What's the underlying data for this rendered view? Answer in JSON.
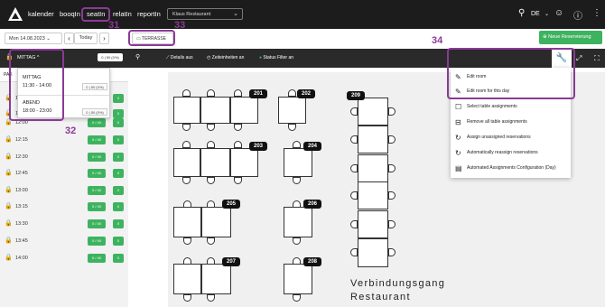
{
  "topbar": {
    "nav": [
      "kalender",
      "booqIn",
      "seatIn",
      "relatIn",
      "reportIn"
    ],
    "restaurant": "Klaus Restaurant",
    "language": "DE"
  },
  "toolbar": {
    "date": "Mon 14.08.2023",
    "today": "Today",
    "area": "TERRASSE",
    "new_reservation": "Neue Reservierung"
  },
  "controls": {
    "shift": "MITTAG",
    "capacity": "0 | 50 (0%)",
    "details": "Details aus",
    "time_units": "Zeiteinheiten an",
    "status_filter": "Status Filter an"
  },
  "shift_dropdown": [
    {
      "name": "MITTAG",
      "hours": "11:30 - 14:00",
      "capacity": "0 | 50 (0%)"
    },
    {
      "name": "ABEND",
      "hours": "18:00 - 23:00",
      "capacity": "0 | 50 (0%)"
    }
  ],
  "sidebar": {
    "header": "PAX",
    "slots": [
      {
        "time": "11:30",
        "occ": "0 / 40",
        "n": "0"
      },
      {
        "time": "11:45",
        "occ": "0 / 40",
        "n": "0"
      },
      {
        "time": "12:00",
        "occ": "0 / 40",
        "n": "0"
      },
      {
        "time": "12:15",
        "occ": "0 / 40",
        "n": "0"
      },
      {
        "time": "12:30",
        "occ": "0 / 40",
        "n": "0"
      },
      {
        "time": "12:45",
        "occ": "0 / 40",
        "n": "0"
      },
      {
        "time": "13:00",
        "occ": "0 / 40",
        "n": "0"
      },
      {
        "time": "13:15",
        "occ": "0 / 40",
        "n": "0"
      },
      {
        "time": "13:30",
        "occ": "0 / 40",
        "n": "0"
      },
      {
        "time": "13:45",
        "occ": "0 / 40",
        "n": "0"
      },
      {
        "time": "14:00",
        "occ": "0 / 40",
        "n": "0"
      }
    ]
  },
  "tables": [
    "201",
    "202",
    "203",
    "204",
    "205",
    "206",
    "207",
    "208",
    "209"
  ],
  "venue": {
    "line1": "Verbindungsgang",
    "line2": "Restaurant"
  },
  "room_menu": [
    {
      "label": "Edit room",
      "icon": "pencil-icon"
    },
    {
      "label": "Edit room for this day",
      "icon": "pencil-calendar-icon"
    },
    {
      "label": "Select table assignments",
      "icon": "checkbox-icon"
    },
    {
      "label": "Remove all table assignments",
      "icon": "remove-icon"
    },
    {
      "label": "Assign unassigned reservations",
      "icon": "assign-icon"
    },
    {
      "label": "Automatically reassign reservations",
      "icon": "auto-assign-icon"
    },
    {
      "label": "Automated Assignments Configuration (Day)",
      "icon": "config-icon"
    }
  ],
  "annotations": [
    "31",
    "32",
    "33",
    "34"
  ],
  "colors": {
    "accent": "#8b3a96",
    "green": "#3eb35f",
    "dark": "#1c1c1c"
  }
}
